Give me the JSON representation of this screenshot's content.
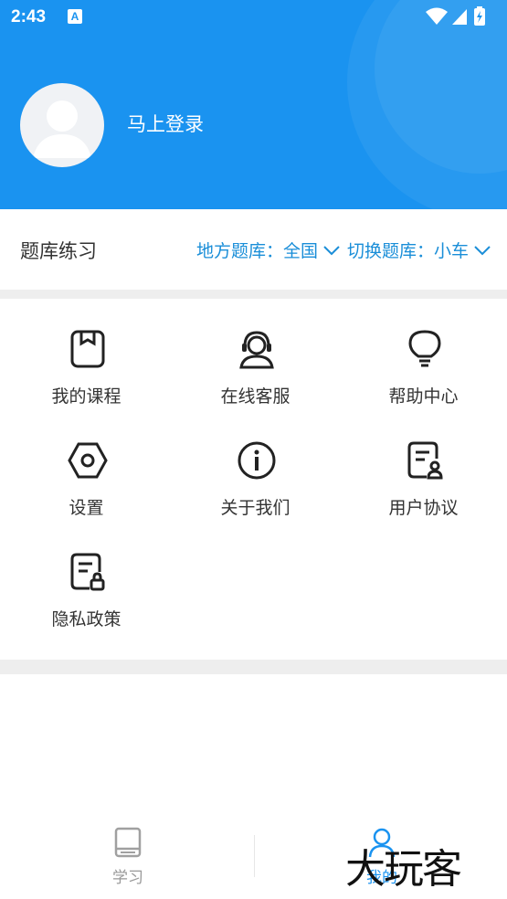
{
  "status_bar": {
    "time": "2:43",
    "app_icon_letter": "A"
  },
  "profile": {
    "login_label": "马上登录"
  },
  "question_bank": {
    "title": "题库练习",
    "region_label": "地方题库：全国",
    "switch_label": "切换题库：小车"
  },
  "menu": [
    {
      "label": "我的课程",
      "icon": "book-icon"
    },
    {
      "label": "在线客服",
      "icon": "headset-icon"
    },
    {
      "label": "帮助中心",
      "icon": "lightbulb-icon"
    },
    {
      "label": "设置",
      "icon": "settings-hexagon-icon"
    },
    {
      "label": "关于我们",
      "icon": "info-icon"
    },
    {
      "label": "用户协议",
      "icon": "document-user-icon"
    },
    {
      "label": "隐私政策",
      "icon": "document-lock-icon"
    }
  ],
  "bottom_nav": {
    "study_label": "学习",
    "mine_label": "我的"
  },
  "watermark": "大玩客",
  "colors": {
    "primary": "#1a93f0",
    "link": "#1a8ed8",
    "separator": "#eeeeee"
  }
}
